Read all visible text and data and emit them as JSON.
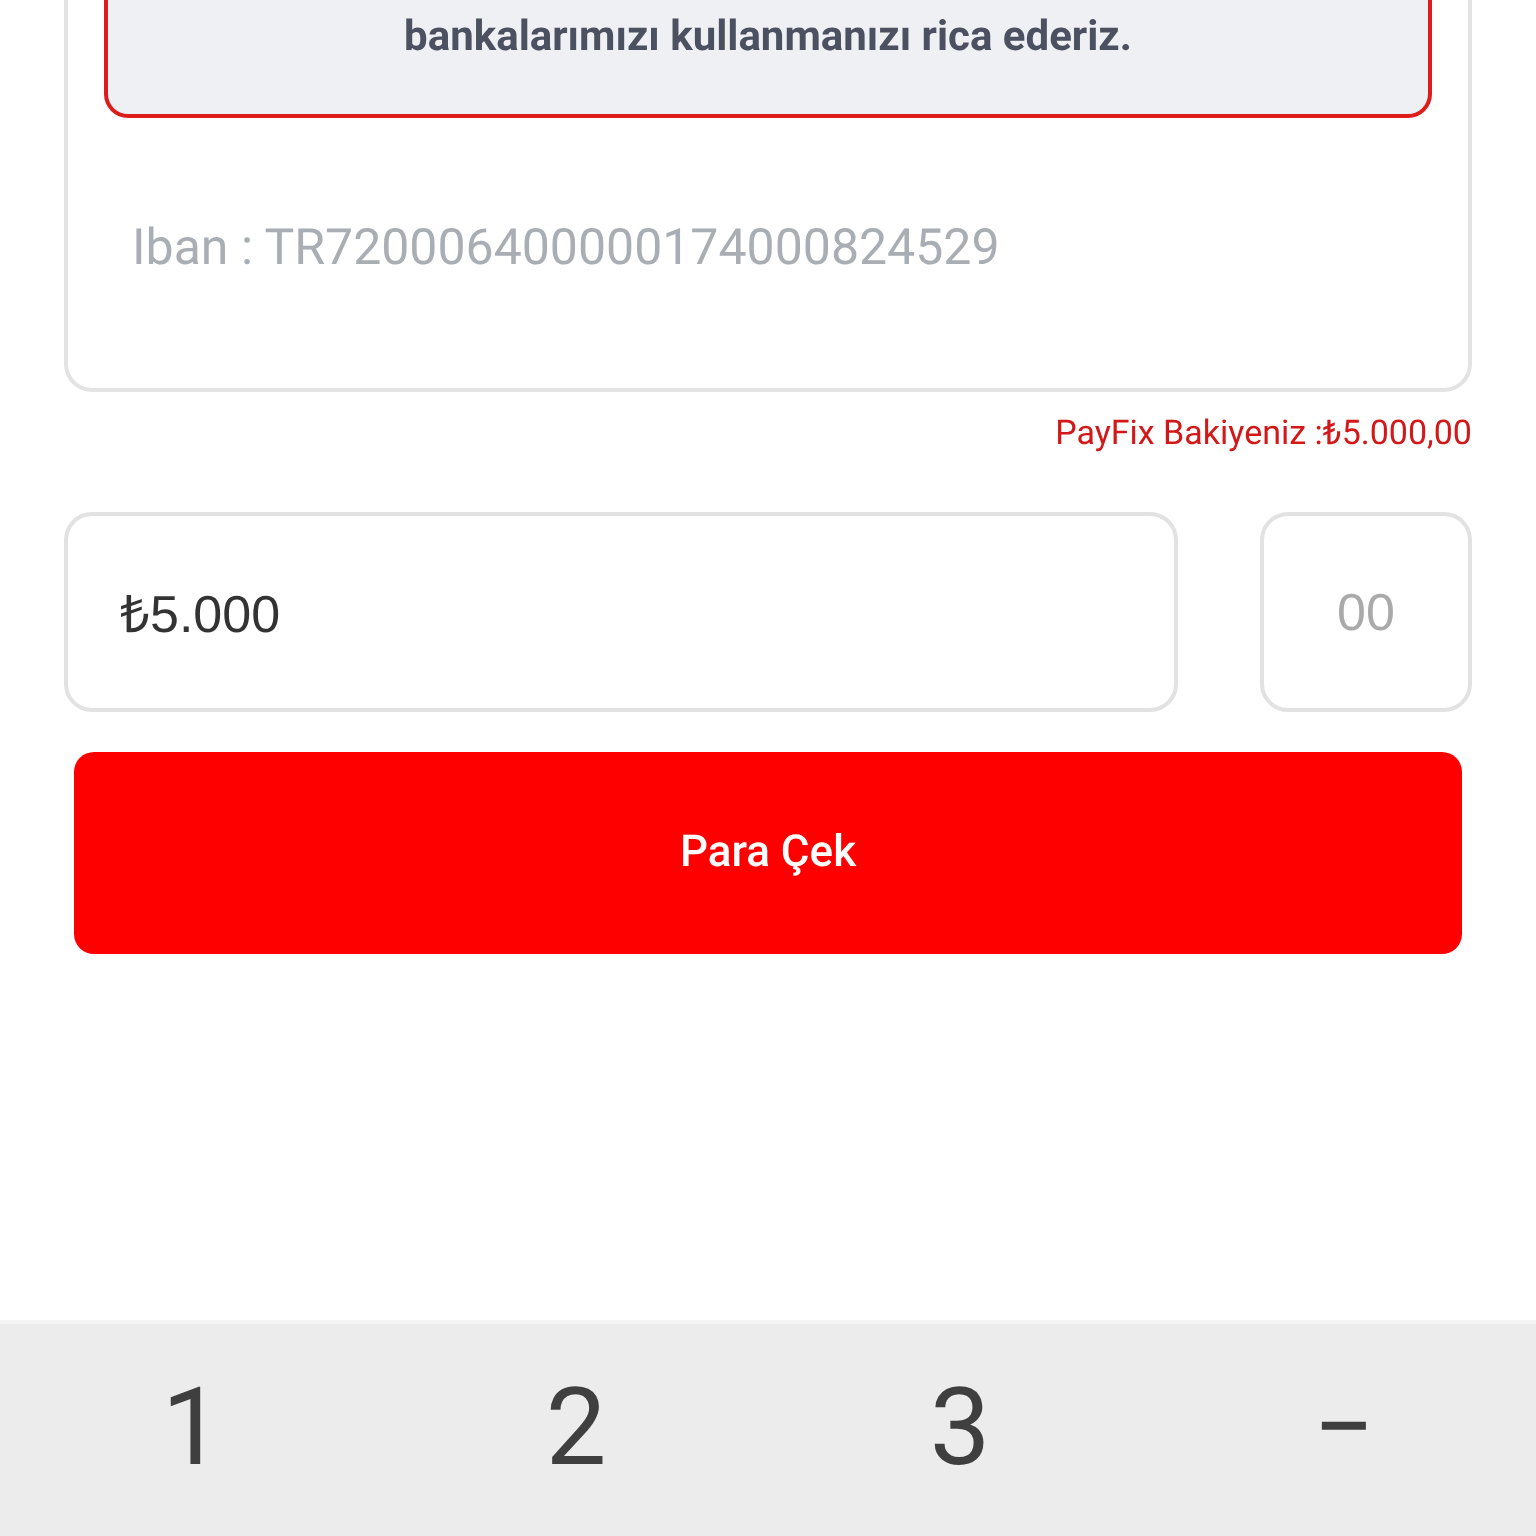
{
  "notice": {
    "text": "bankalarımızı kullanmanızı rica ederiz."
  },
  "iban": {
    "text": "Iban : TR720006400000174000824529"
  },
  "balance": {
    "text": "PayFix Bakiyeniz :₺5.000,00"
  },
  "amount": {
    "value": "₺5.000"
  },
  "cents": {
    "placeholder": "00"
  },
  "submit_button": {
    "label": "Para Çek"
  },
  "keyboard": {
    "keys": [
      "1",
      "2",
      "3",
      "−"
    ]
  }
}
